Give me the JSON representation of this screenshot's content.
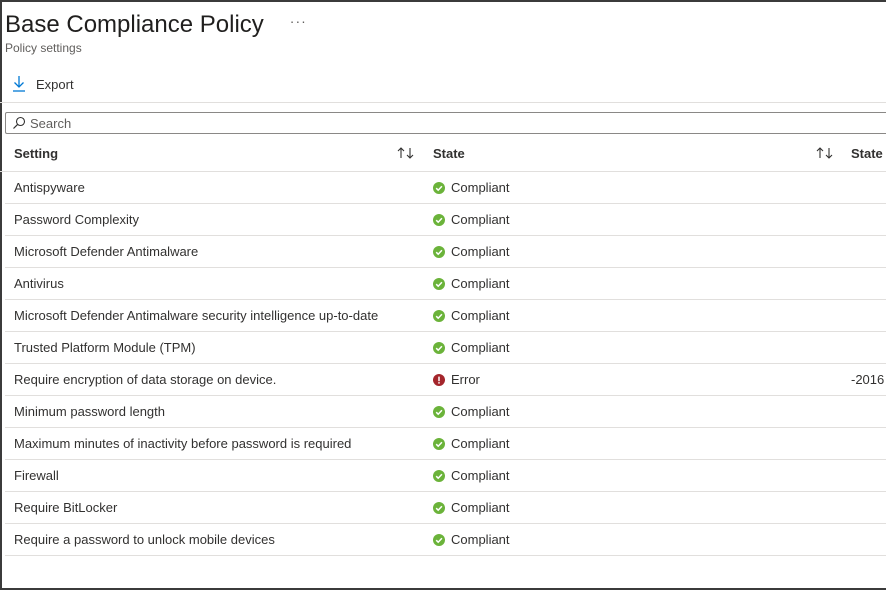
{
  "header": {
    "title": "Base Compliance Policy",
    "more_label": "···",
    "subtitle": "Policy settings"
  },
  "toolbar": {
    "export_label": "Export",
    "export_icon": "download-icon"
  },
  "search": {
    "placeholder": "Search",
    "value": "",
    "icon": "search-icon"
  },
  "table": {
    "columns": [
      {
        "label": "Setting",
        "sortable": true
      },
      {
        "label": "State",
        "sortable": true
      },
      {
        "label": "State",
        "sortable": false
      }
    ],
    "rows": [
      {
        "setting": "Antispyware",
        "state": "Compliant",
        "status": "compliant",
        "extra": ""
      },
      {
        "setting": "Password Complexity",
        "state": "Compliant",
        "status": "compliant",
        "extra": ""
      },
      {
        "setting": "Microsoft Defender Antimalware",
        "state": "Compliant",
        "status": "compliant",
        "extra": ""
      },
      {
        "setting": "Antivirus",
        "state": "Compliant",
        "status": "compliant",
        "extra": ""
      },
      {
        "setting": "Microsoft Defender Antimalware security intelligence up-to-date",
        "state": "Compliant",
        "status": "compliant",
        "extra": ""
      },
      {
        "setting": "Trusted Platform Module (TPM)",
        "state": "Compliant",
        "status": "compliant",
        "extra": ""
      },
      {
        "setting": "Require encryption of data storage on device.",
        "state": "Error",
        "status": "error",
        "extra": "-2016"
      },
      {
        "setting": "Minimum password length",
        "state": "Compliant",
        "status": "compliant",
        "extra": ""
      },
      {
        "setting": "Maximum minutes of inactivity before password is required",
        "state": "Compliant",
        "status": "compliant",
        "extra": ""
      },
      {
        "setting": "Firewall",
        "state": "Compliant",
        "status": "compliant",
        "extra": ""
      },
      {
        "setting": "Require BitLocker",
        "state": "Compliant",
        "status": "compliant",
        "extra": ""
      },
      {
        "setting": "Require a password to unlock mobile devices",
        "state": "Compliant",
        "status": "compliant",
        "extra": ""
      }
    ]
  },
  "colors": {
    "compliant": "#6bb33a",
    "error": "#a4262c",
    "accent": "#0078d4"
  }
}
